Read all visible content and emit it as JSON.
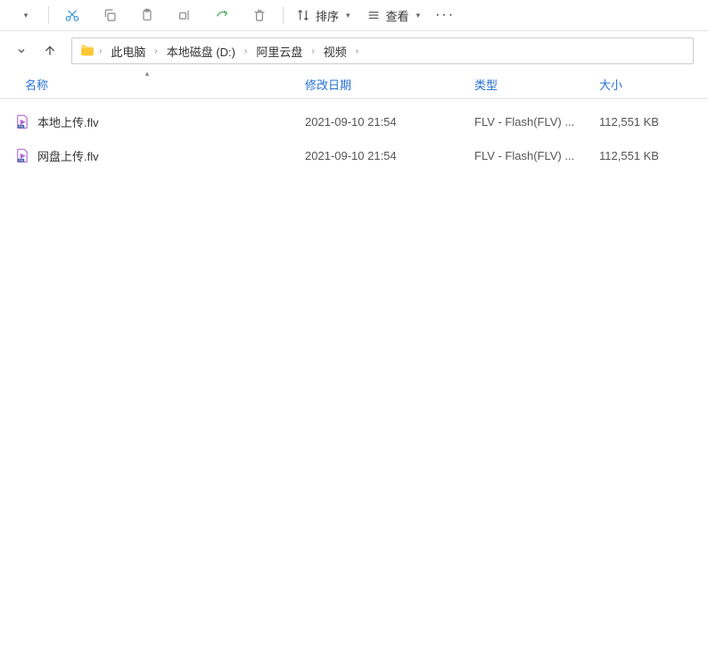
{
  "toolbar": {
    "sort_label": "排序",
    "view_label": "查看"
  },
  "breadcrumb": {
    "items": [
      "此电脑",
      "本地磁盘 (D:)",
      "阿里云盘",
      "视频"
    ]
  },
  "columns": {
    "name": "名称",
    "date": "修改日期",
    "type": "类型",
    "size": "大小"
  },
  "files": [
    {
      "name": "本地上传.flv",
      "date": "2021-09-10 21:54",
      "type": "FLV - Flash(FLV) ...",
      "size": "112,551 KB"
    },
    {
      "name": "网盘上传.flv",
      "date": "2021-09-10 21:54",
      "type": "FLV - Flash(FLV) ...",
      "size": "112,551 KB"
    }
  ]
}
